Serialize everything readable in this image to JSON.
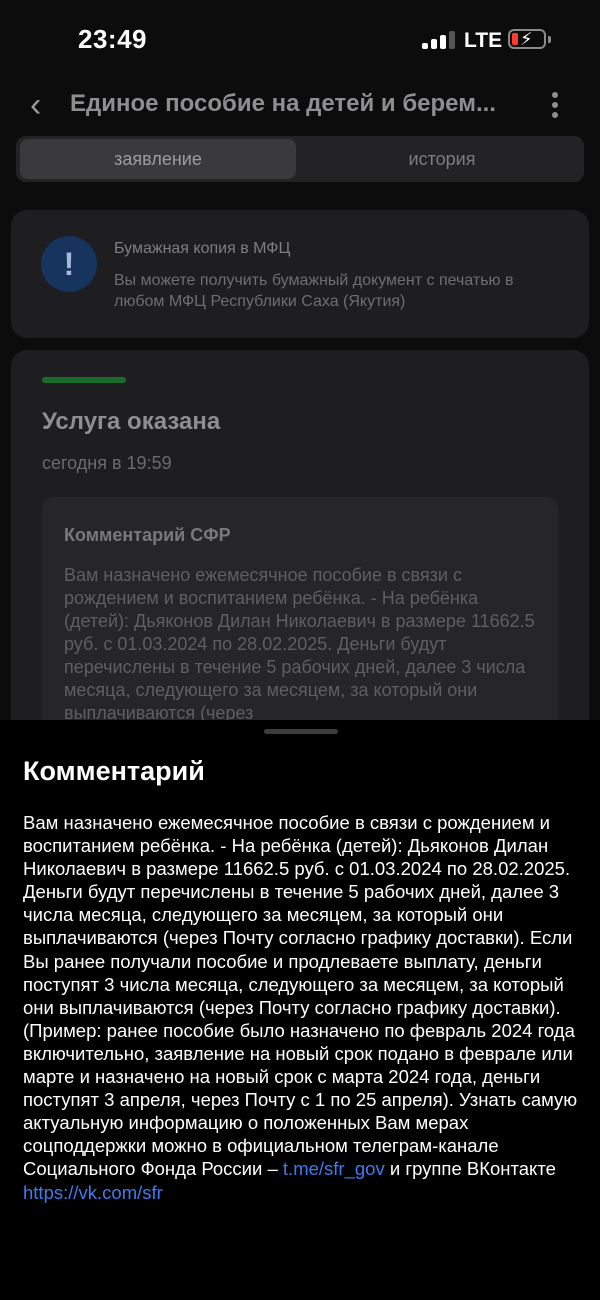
{
  "status_bar": {
    "time": "23:49",
    "network": "LTE",
    "signal_bars": 3,
    "battery_level": 0.15,
    "battery_color": "#ff3b30"
  },
  "header": {
    "title": "Единое пособие на детей и берем..."
  },
  "tabs": [
    {
      "label": "заявление",
      "active": true
    },
    {
      "label": "история",
      "active": false
    }
  ],
  "info_card": {
    "icon": "exclamation-icon",
    "title": "Бумажная копия в МФЦ",
    "text": "Вы можете получить бумажный документ с печатью в любом МФЦ Республики Саха (Якутия)"
  },
  "status_card": {
    "accent": "#1b6b2a",
    "title": "Услуга оказана",
    "date": "сегодня в 19:59",
    "comment_title": "Комментарий СФР",
    "comment_preview": "Вам назначено ежемесячное пособие в связи с рождением и воспитанием ребёнка. - На ребёнка (детей): Дьяконов Дилан Николаевич в размере 11662.5 руб. с 01.03.2024 по 28.02.2025. Деньги будут перечислены в течение 5 рабочих дней, далее 3 числа месяца, следующего за месяцем, за который они выплачиваются (через"
  },
  "sheet": {
    "title": "Комментарий",
    "text_main": "Вам назначено ежемесячное пособие в связи с рождением и воспитанием ребёнка. - На ребёнка (детей): Дьяконов Дилан Николаевич в размере 11662.5 руб. с 01.03.2024 по 28.02.2025. Деньги будут перечислены в течение 5 рабочих дней, далее 3 числа месяца, следующего за месяцем, за который они выплачиваются (через Почту согласно графику доставки). Если Вы ранее получали пособие и продлеваете выплату, деньги поступят 3 числа месяца, следующего за месяцем, за который они выплачиваются (через Почту согласно графику доставки). (Пример: ранее пособие было назначено по февраль 2024 года включительно, заявление на новый срок подано в феврале или марте и назначено на новый срок с марта 2024 года, деньги поступят 3 апреля, через Почту с 1 по 25 апреля). Узнать самую актуальную информацию о положенных Вам мерах соцподдержки можно в официальном телеграм-канале Социального Фонда России – ",
    "link1": "t.me/sfr_gov",
    "text_mid": " и группе ВКонтакте ",
    "link2": "https://vk.com/sfr",
    "link_color": "#3d7cf2"
  }
}
